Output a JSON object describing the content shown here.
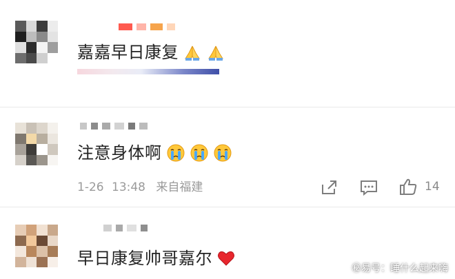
{
  "comments": [
    {
      "text": "嘉嘉早日康复",
      "emoji": [
        "folded-hands",
        "folded-hands"
      ]
    },
    {
      "text": "注意身体啊",
      "emoji": [
        "crying-face",
        "crying-face",
        "crying-face"
      ],
      "date": "1-26",
      "time": "13:48",
      "location": "来自福建",
      "likes": "14"
    },
    {
      "text": "早日康复帅哥嘉尔",
      "emoji": [
        "red-heart"
      ]
    }
  ],
  "watermark": "㊙易号：睡什么起来嗨",
  "colors": {
    "text": "#222222",
    "meta": "#9a9a9a",
    "heart": "#e8262d",
    "emoji_yellow": "#ffc83a"
  }
}
